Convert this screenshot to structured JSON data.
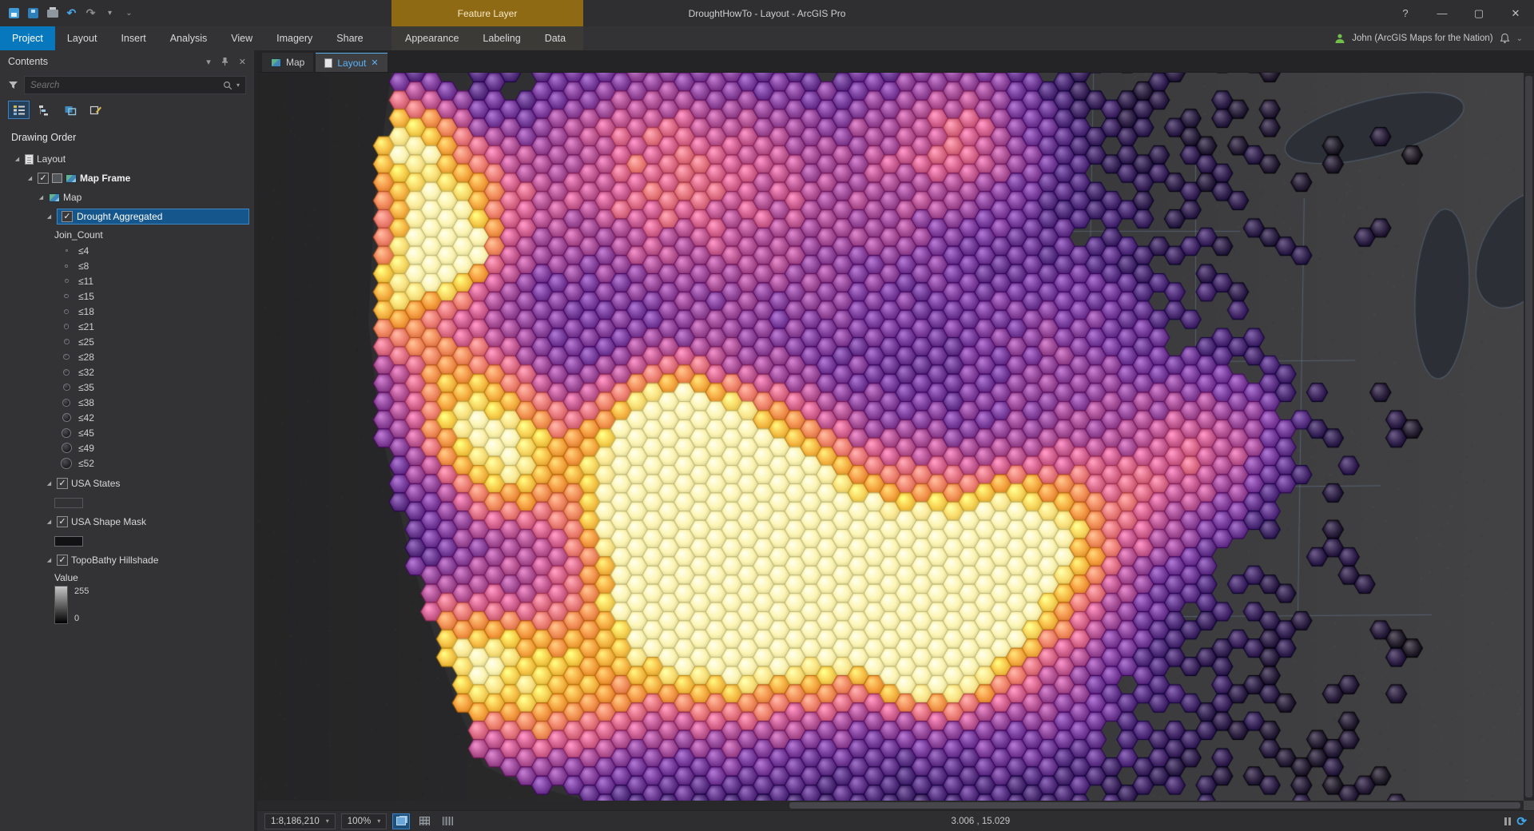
{
  "window": {
    "title": "DroughtHowTo - Layout - ArcGIS Pro",
    "contextual_group_label": "Feature Layer",
    "user_name": "John (ArcGIS Maps for the Nation)",
    "help_label": "?"
  },
  "ribbon": {
    "tabs": [
      "Project",
      "Layout",
      "Insert",
      "Analysis",
      "View",
      "Imagery",
      "Share"
    ],
    "active_tab": "Project",
    "contextual_tabs": [
      "Appearance",
      "Labeling",
      "Data"
    ]
  },
  "doc_tabs": {
    "map": "Map",
    "layout": "Layout"
  },
  "contents_panel": {
    "title": "Contents",
    "search_placeholder": "Search",
    "drawing_order": "Drawing Order",
    "tree": {
      "layout": "Layout",
      "map_frame": "Map Frame",
      "map": "Map",
      "drought": "Drought Aggregated",
      "field": "Join_Count",
      "classes": [
        "≤4",
        "≤8",
        "≤11",
        "≤15",
        "≤18",
        "≤21",
        "≤25",
        "≤28",
        "≤32",
        "≤35",
        "≤38",
        "≤42",
        "≤45",
        "≤49",
        "≤52"
      ],
      "usa_states": "USA States",
      "usa_shape_mask": "USA Shape Mask",
      "topobathy": "TopoBathy Hillshade",
      "value_label": "Value",
      "value_max": "255",
      "value_min": "0"
    }
  },
  "status_bar": {
    "scale": "1:8,186,210",
    "zoom": "100%",
    "coordinates": "3.006 , 15.029"
  },
  "icons": {
    "close": "✕",
    "chevron_down": "▾",
    "chevron_small": "⌄",
    "minimize": "—",
    "maximize": "▢",
    "undo": "↶",
    "redo": "↷",
    "expander": "◢",
    "check": "✓",
    "refresh": "⟳"
  },
  "colors": {
    "accent_blue": "#0878be",
    "selection_blue": "#15568c",
    "contextual_orange": "#8f6a14",
    "user_green": "#6fbf4a",
    "active_tab_text": "#58b2f6"
  },
  "map_render": {
    "basemap": "#39393b",
    "ocean_shade": "rgba(0,0,0,0.16)",
    "line_color": "rgba(118,144,180,0.40)",
    "lake_color": "#2c3036",
    "palette": [
      [
        0.0,
        "#232026"
      ],
      [
        0.13,
        "#342450"
      ],
      [
        0.28,
        "#53307e"
      ],
      [
        0.42,
        "#7a3f9d"
      ],
      [
        0.55,
        "#a74f96"
      ],
      [
        0.65,
        "#d3628f"
      ],
      [
        0.74,
        "#ee7f72"
      ],
      [
        0.83,
        "#f59b3e"
      ],
      [
        0.91,
        "#f8cf4c"
      ],
      [
        1.0,
        "#fdf5b4"
      ]
    ]
  }
}
